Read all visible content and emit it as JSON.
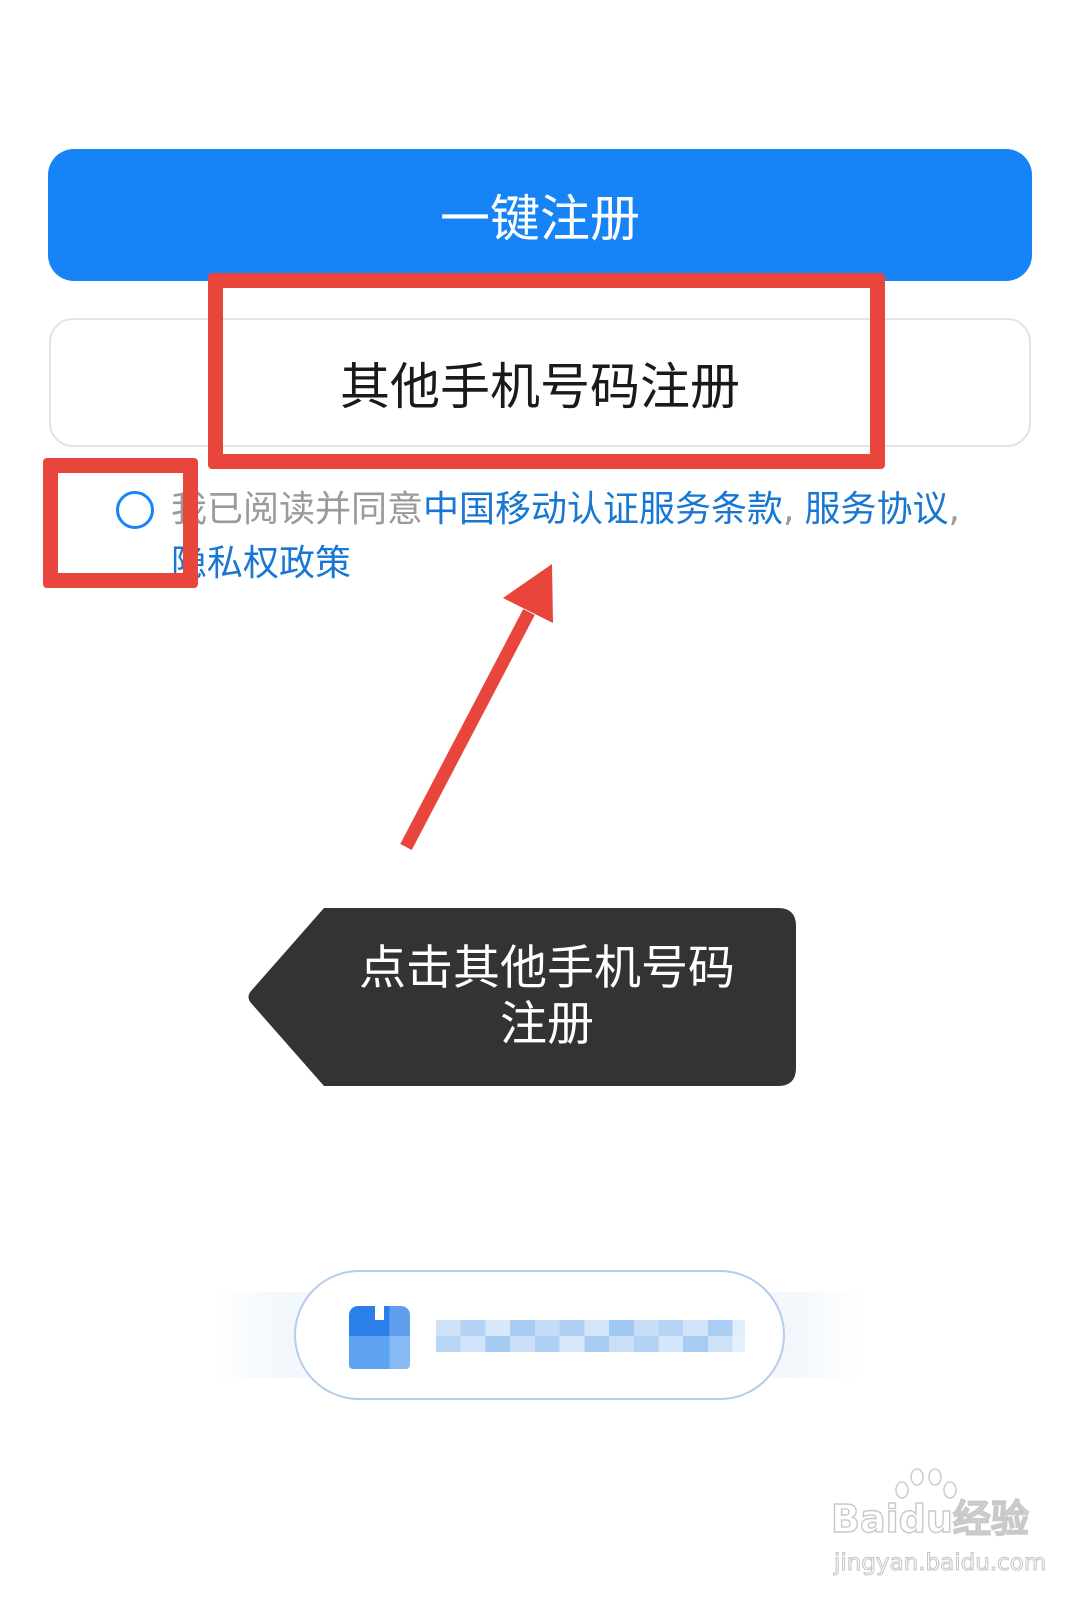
{
  "buttons": {
    "one_click_register": "一键注册",
    "other_phone_register": "其他手机号码注册"
  },
  "agreement": {
    "checked": false,
    "prefix": "我已阅读并同意",
    "link_1": "中国移动认证服务条款",
    "sep_1": ",",
    "link_2": "服务协议",
    "sep_2": ",",
    "link_3": "隐私权政策"
  },
  "bottom_login": {
    "icon": "app-icon"
  },
  "annotation": {
    "callout_line_1": "点击其他手机号码",
    "callout_line_2": "注册"
  },
  "watermark": {
    "logo_icon": "paw-logo-icon",
    "brand": "Baidu经验",
    "url": "jingyan.baidu.com"
  },
  "colors": {
    "primary_blue": "#1684f6",
    "link_blue": "#1877d2",
    "highlight_red": "#e8453c",
    "callout_bg": "#333333",
    "muted_text": "#9a9a9a"
  }
}
